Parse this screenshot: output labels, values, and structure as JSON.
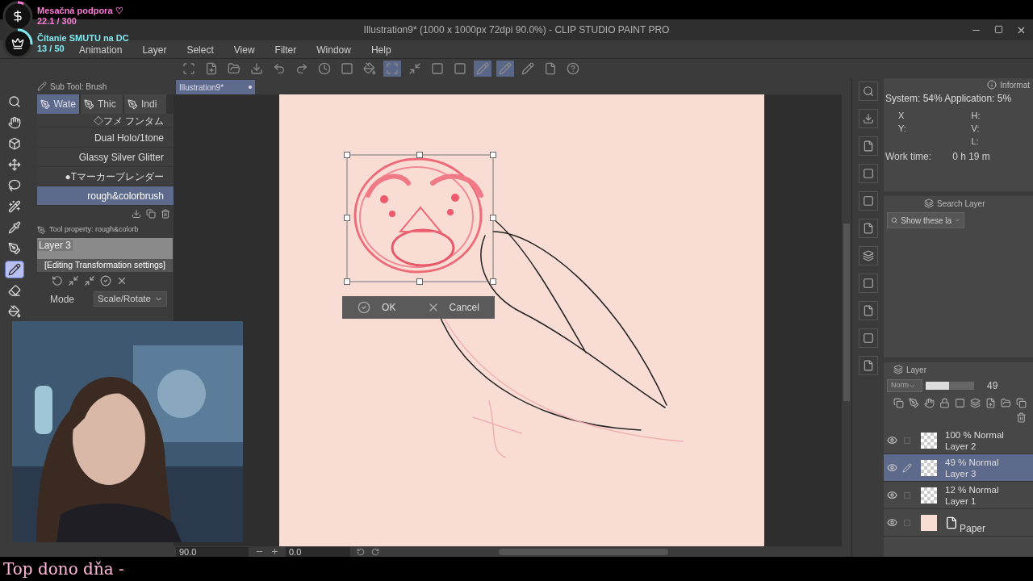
{
  "overlay": {
    "goals": [
      {
        "kind": "money",
        "title": "Mesačná podpora ♡",
        "progress": "22.1 / 300",
        "level": 0.07,
        "color": "#ff7ad9"
      },
      {
        "kind": "crown",
        "title": "Čítanie SMUTU na DC",
        "progress": "13 / 50",
        "level": 0.26,
        "color": "#7fe8f0"
      }
    ],
    "ticker": "Top dono dňa -"
  },
  "window": {
    "title": "Illustration9* (1000 x 1000px 72dpi 90.0%)  - CLIP STUDIO PAINT PRO"
  },
  "menu": [
    "Animation",
    "Layer",
    "Select",
    "View",
    "Filter",
    "Window",
    "Help"
  ],
  "document_tab": "Illustration9*",
  "tools": [
    {
      "kind": "zoom",
      "selected": false
    },
    {
      "kind": "hand",
      "selected": false
    },
    {
      "kind": "object",
      "selected": false
    },
    {
      "kind": "move",
      "selected": false
    },
    {
      "kind": "lasso",
      "selected": false
    },
    {
      "kind": "wand",
      "selected": false
    },
    {
      "kind": "eyedropper",
      "selected": false
    },
    {
      "kind": "pen",
      "selected": false
    },
    {
      "kind": "pencil",
      "selected": true
    },
    {
      "kind": "eraser",
      "selected": false
    },
    {
      "kind": "fill",
      "selected": false
    }
  ],
  "sub_tool": {
    "title": "Sub Tool: Brush",
    "tabs": [
      {
        "label": "Wate",
        "selected": true
      },
      {
        "label": "Thic",
        "selected": false
      },
      {
        "label": "Indi",
        "selected": false
      }
    ],
    "brushes": [
      {
        "name": "◇フメ フンタム",
        "selected": false
      },
      {
        "name": "Dual Holo/1tone",
        "selected": false
      },
      {
        "name": "Glassy Silver Glitter",
        "selected": false
      },
      {
        "name": "●Tマーカーブレンダー",
        "selected": false
      },
      {
        "name": "rough&colorbrush",
        "selected": true
      }
    ]
  },
  "tool_property": {
    "title": "Tool property: rough&colorb",
    "layer": "Layer 3",
    "heading": "[Editing Transformation settings]",
    "mode_label": "Mode",
    "mode_value": "Scale/Rotate"
  },
  "transform_bar": {
    "ok": "OK",
    "cancel": "Cancel"
  },
  "info": {
    "tab": "Informat",
    "usage": "System: 54% Application:  5%",
    "x": "X",
    "y": "Y:",
    "h": "H:",
    "v": "V:",
    "l": "L:",
    "work_time_label": "Work time:",
    "work_time": "0 h 19 m"
  },
  "search_layer": {
    "tab": "Search Layer",
    "filter": "Show these la"
  },
  "layer_panel": {
    "tab": "Layer",
    "blend": "Norm",
    "opacity": "49",
    "level": 0.49,
    "layers": [
      {
        "kind": "raster",
        "mode": "100 % Normal",
        "name": "Layer 2",
        "visible": true,
        "editing": false,
        "selected": false
      },
      {
        "kind": "raster",
        "mode": "49 % Normal",
        "name": "Layer 3",
        "visible": true,
        "editing": true,
        "selected": true
      },
      {
        "kind": "raster",
        "mode": "12 % Normal",
        "name": "Layer 1",
        "visible": true,
        "editing": false,
        "selected": false
      },
      {
        "kind": "paper",
        "name": "Paper",
        "visible": true,
        "editing": false,
        "selected": false
      }
    ]
  },
  "status": {
    "zoom": "90.0",
    "angle": "0.0"
  }
}
